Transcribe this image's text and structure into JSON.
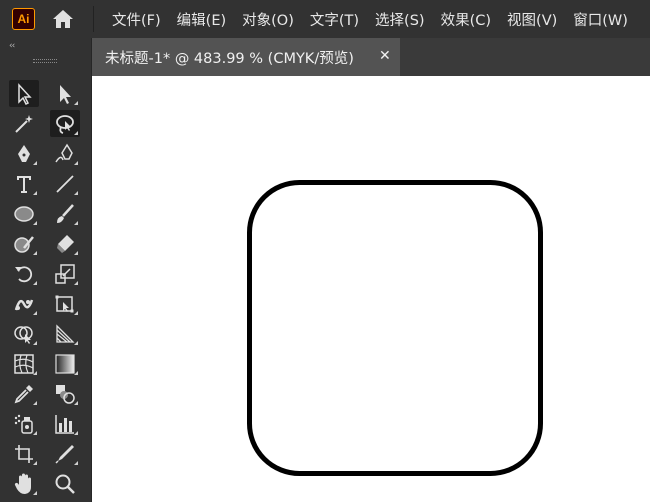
{
  "app": {
    "logo_text": "Ai",
    "accent": "#ff9a00"
  },
  "menu": {
    "items": [
      "文件(F)",
      "编辑(E)",
      "对象(O)",
      "文字(T)",
      "选择(S)",
      "效果(C)",
      "视图(V)",
      "窗口(W)"
    ]
  },
  "document_tab": {
    "title": "未标题-1* @ 483.99 % (CMYK/预览)",
    "close_glyph": "✕"
  },
  "toolbar": {
    "collapse_glyph": "‹‹",
    "tools": [
      "selection-tool",
      "direct-selection-tool",
      "magic-wand-tool",
      "lasso-tool",
      "pen-tool",
      "curvature-tool",
      "type-tool",
      "line-segment-tool",
      "ellipse-tool",
      "paintbrush-tool",
      "shaper-tool",
      "eraser-tool",
      "rotate-tool",
      "scale-tool",
      "puppet-warp-tool",
      "free-transform-tool",
      "shape-builder-tool",
      "perspective-grid-tool",
      "mesh-tool",
      "gradient-tool",
      "eyedropper-tool",
      "blend-tool",
      "symbol-sprayer-tool",
      "column-graph-tool",
      "artboard-tool",
      "slice-tool",
      "hand-tool",
      "zoom-tool"
    ]
  },
  "canvas": {
    "background": "#ffffff",
    "shape": "rounded-rectangle",
    "stroke": "#000000"
  }
}
